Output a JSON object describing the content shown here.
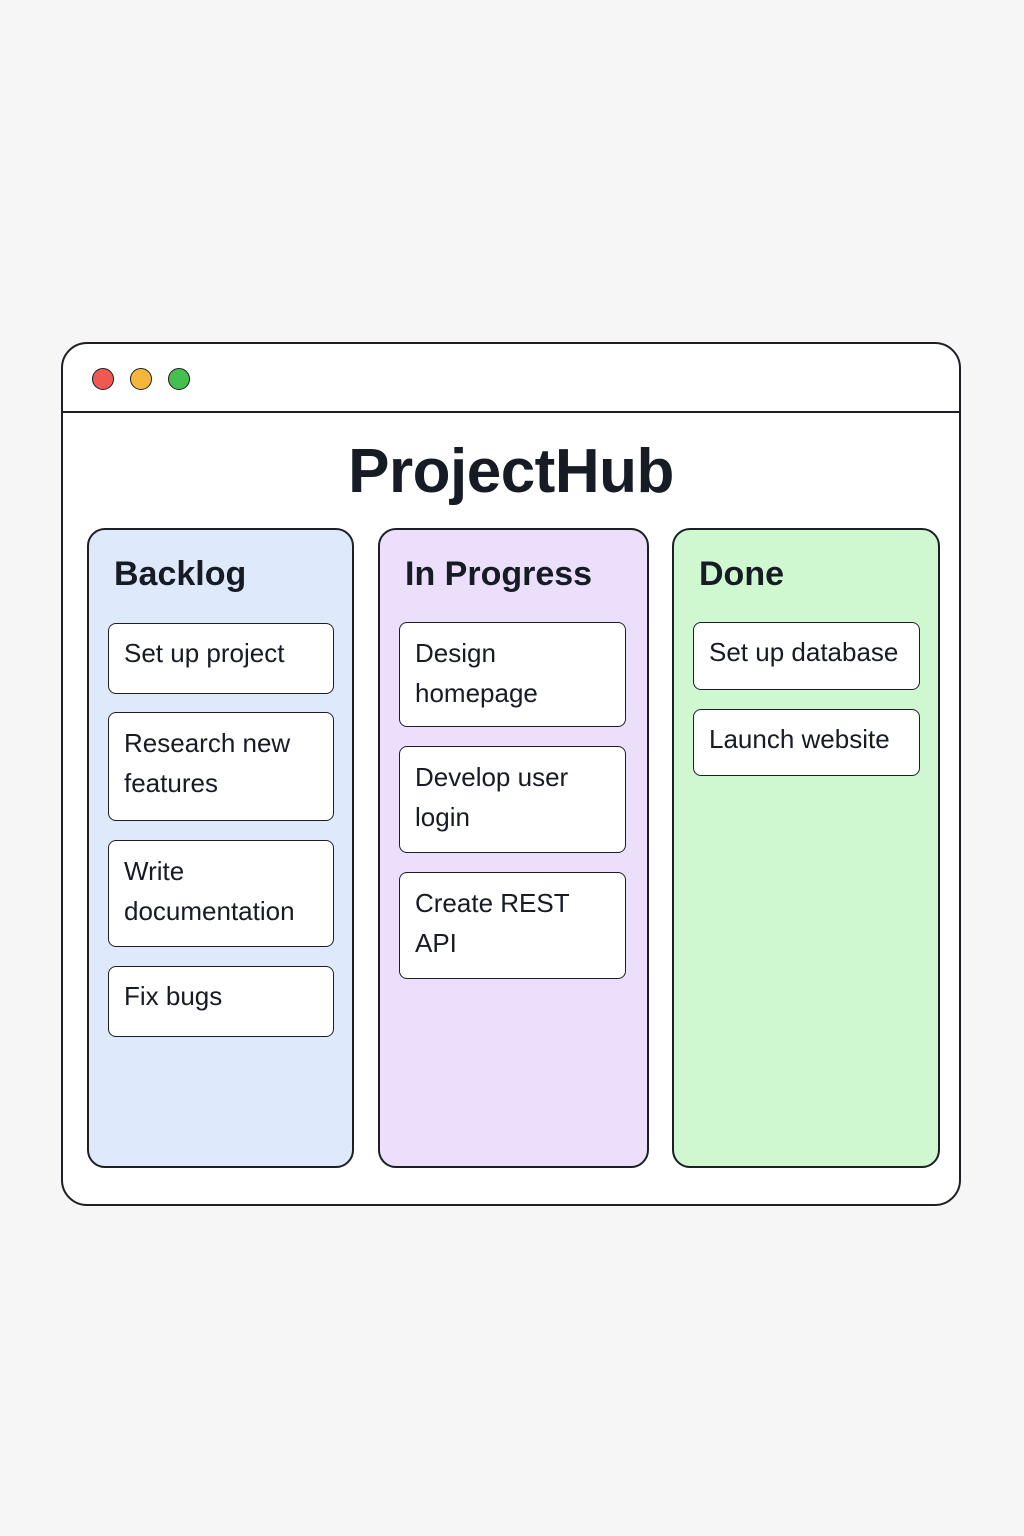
{
  "window": {
    "controls": [
      {
        "name": "close",
        "color": "#ee5a52"
      },
      {
        "name": "minimize",
        "color": "#f5b73b"
      },
      {
        "name": "maximize",
        "color": "#45c04e"
      }
    ]
  },
  "app": {
    "title": "ProjectHub"
  },
  "board": {
    "columns": [
      {
        "title": "Backlog",
        "color": "#deeafc",
        "cards": [
          "Set up project",
          "Research new features",
          "Write documentation",
          "Fix bugs"
        ]
      },
      {
        "title": "In Progress",
        "color": "#ebdffc",
        "cards": [
          "Design homepage",
          "Develop user login",
          "Create REST API"
        ]
      },
      {
        "title": "Done",
        "color": "#cff8d0",
        "cards": [
          "Set up database",
          "Launch website"
        ]
      }
    ]
  }
}
